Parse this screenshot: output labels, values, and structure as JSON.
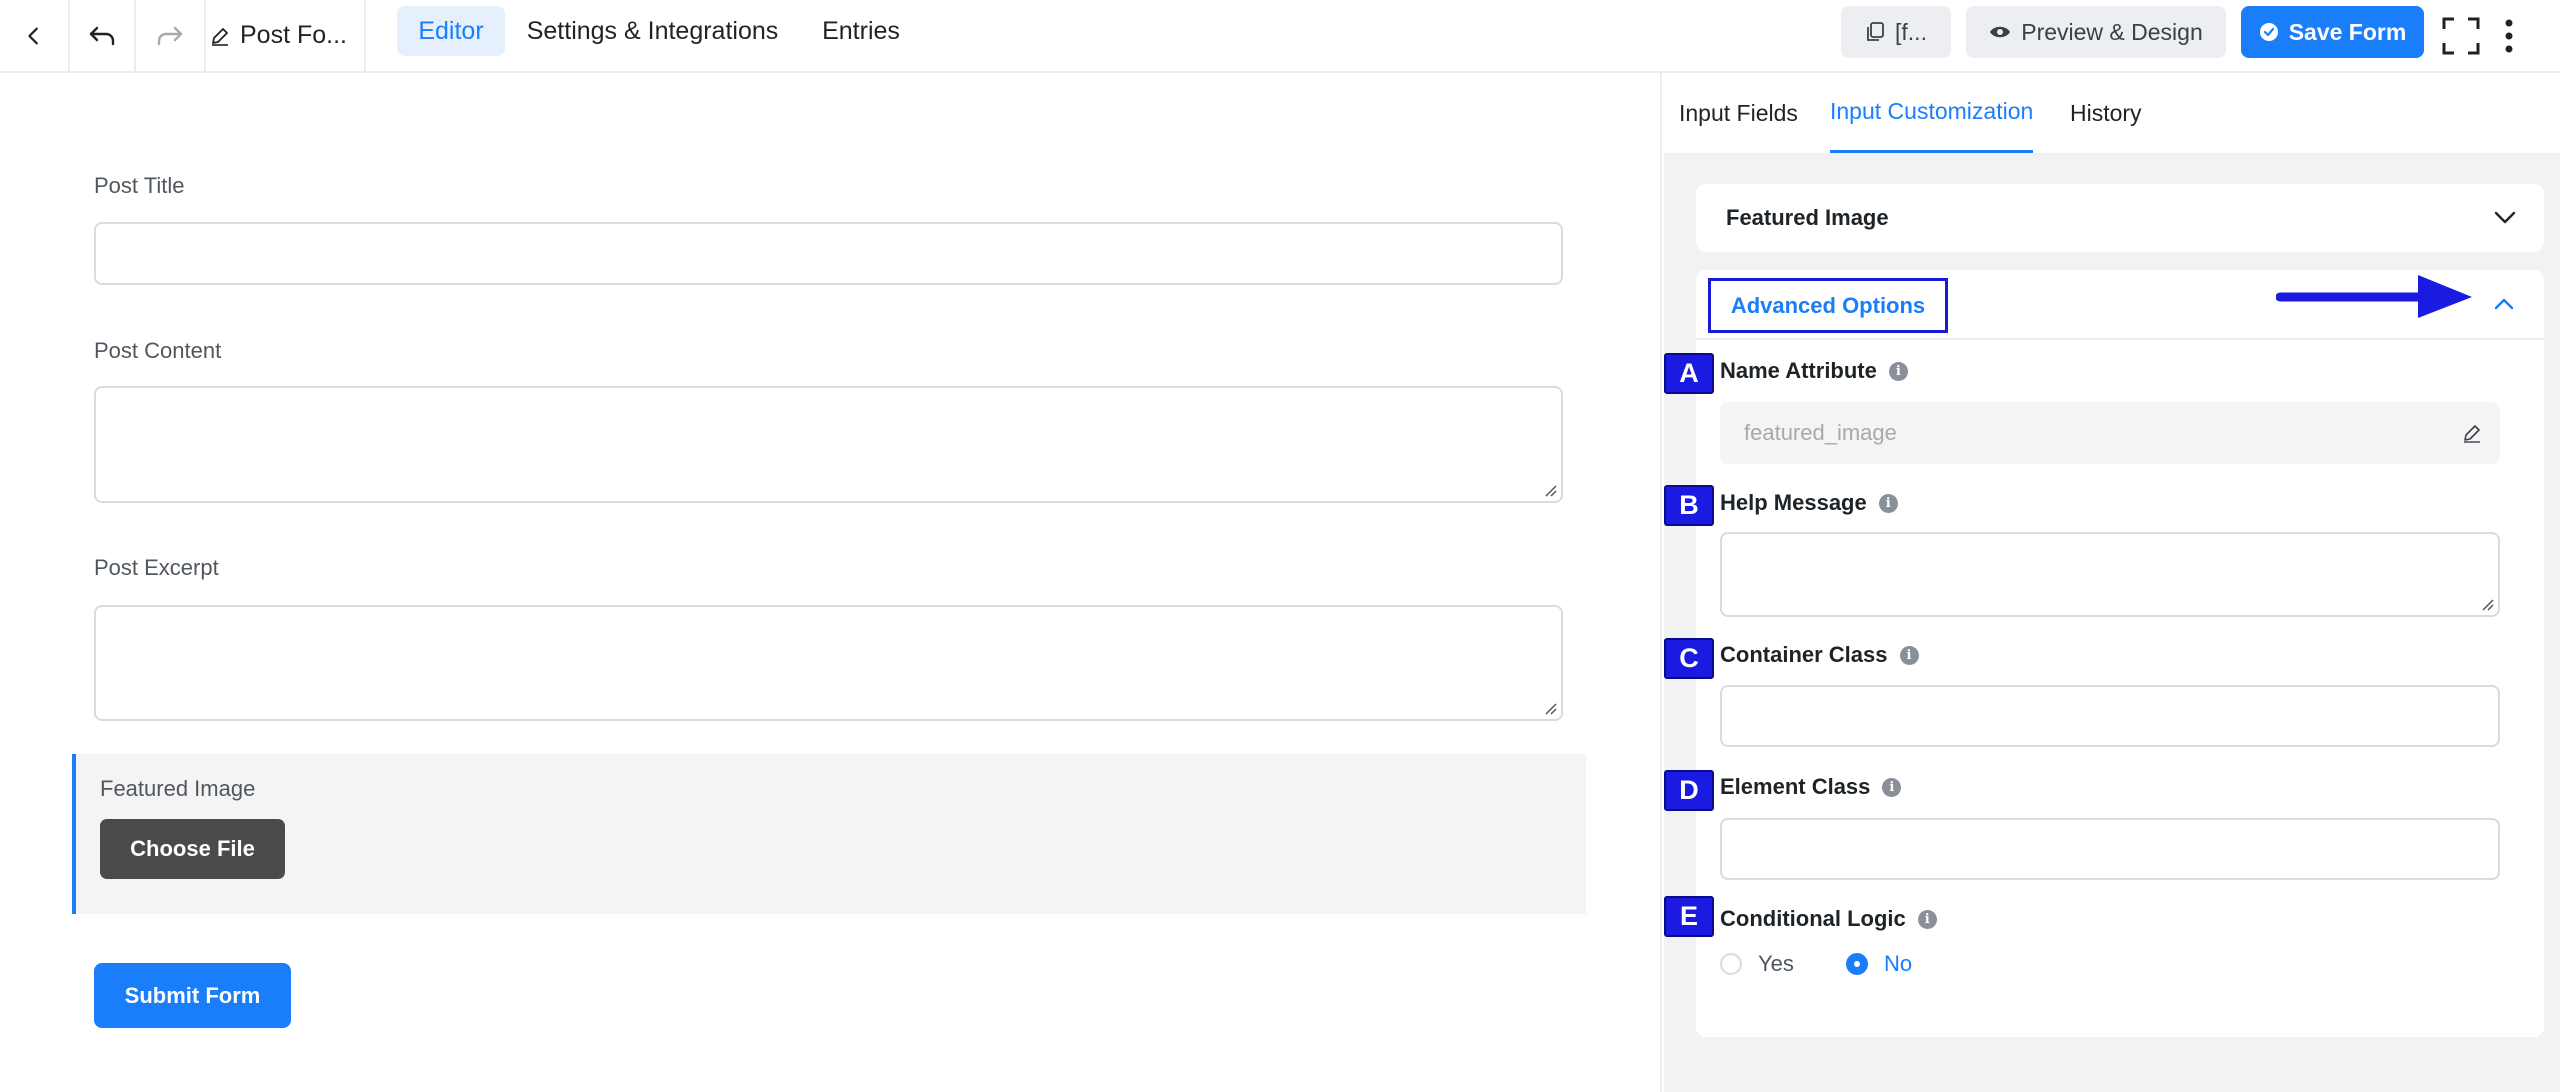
{
  "topbar": {
    "form_title": "Post Fo...",
    "tabs": [
      {
        "label": "Editor",
        "active": true
      },
      {
        "label": "Settings & Integrations",
        "active": false
      },
      {
        "label": "Entries",
        "active": false
      }
    ],
    "shortcode_label": "[f...",
    "preview_label": "Preview & Design",
    "save_label": "Save Form"
  },
  "editor": {
    "post_title_label": "Post Title",
    "post_content_label": "Post Content",
    "post_excerpt_label": "Post Excerpt",
    "featured_image_label": "Featured Image",
    "choose_file_label": "Choose File",
    "submit_label": "Submit Form"
  },
  "panel": {
    "tabs": [
      {
        "label": "Input Fields",
        "active": false
      },
      {
        "label": "Input Customization",
        "active": true
      },
      {
        "label": "History",
        "active": false
      }
    ],
    "featured_image_section": "Featured Image",
    "advanced_options": "Advanced Options",
    "options": [
      {
        "badge": "A",
        "label": "Name Attribute",
        "value": "featured_image"
      },
      {
        "badge": "B",
        "label": "Help Message",
        "value": ""
      },
      {
        "badge": "C",
        "label": "Container Class",
        "value": ""
      },
      {
        "badge": "D",
        "label": "Element Class",
        "value": ""
      },
      {
        "badge": "E",
        "label": "Conditional Logic"
      }
    ],
    "conditional_logic": {
      "yes_label": "Yes",
      "no_label": "No",
      "selected": "No"
    }
  },
  "colors": {
    "accent": "#1a7efb",
    "annotation": "#1a1ae0",
    "dark_button": "#4a4a4a"
  }
}
